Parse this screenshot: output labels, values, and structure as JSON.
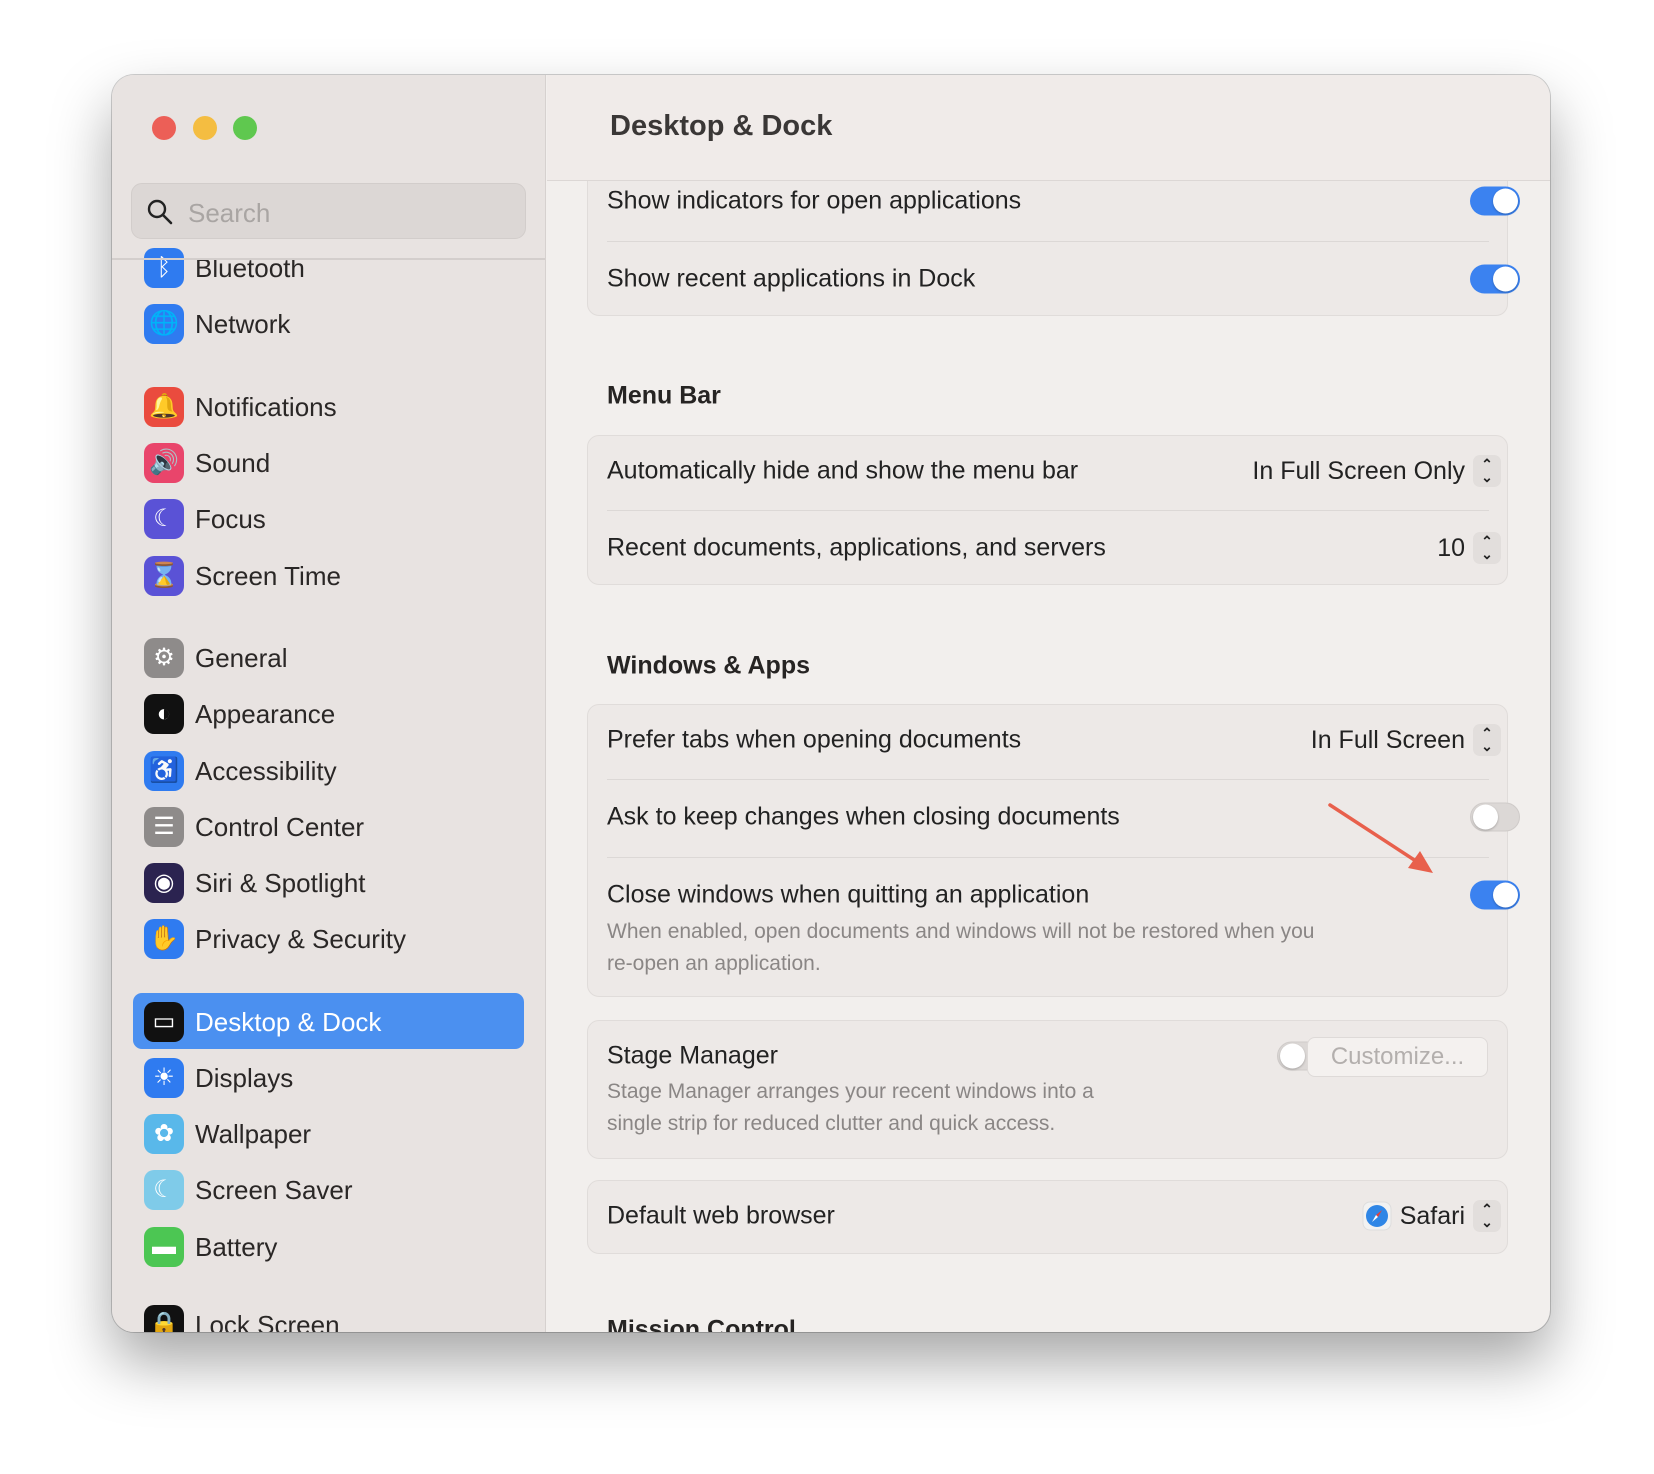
{
  "window": {
    "title": "Desktop & Dock"
  },
  "search": {
    "placeholder": "Search"
  },
  "sidebar": {
    "items": [
      {
        "label": "Bluetooth",
        "icon": "bluetooth-icon",
        "color": "#2f7bf0",
        "glyph": "ᛒ"
      },
      {
        "label": "Network",
        "icon": "globe-icon",
        "color": "#2f7bf0",
        "glyph": "🌐"
      },
      {
        "label": "Notifications",
        "icon": "bell-icon",
        "color": "#ea4b3e",
        "glyph": "🔔"
      },
      {
        "label": "Sound",
        "icon": "speaker-icon",
        "color": "#e9456b",
        "glyph": "🔊"
      },
      {
        "label": "Focus",
        "icon": "moon-icon",
        "color": "#5a52d6",
        "glyph": "☾"
      },
      {
        "label": "Screen Time",
        "icon": "hourglass-icon",
        "color": "#5a52d6",
        "glyph": "⌛"
      },
      {
        "label": "General",
        "icon": "gear-icon",
        "color": "#8e8b8a",
        "glyph": "⚙"
      },
      {
        "label": "Appearance",
        "icon": "appearance-icon",
        "color": "#111111",
        "glyph": "◐"
      },
      {
        "label": "Accessibility",
        "icon": "accessibility-icon",
        "color": "#2f7bf0",
        "glyph": "♿"
      },
      {
        "label": "Control Center",
        "icon": "toggles-icon",
        "color": "#8e8b8a",
        "glyph": "☰"
      },
      {
        "label": "Siri & Spotlight",
        "icon": "siri-icon",
        "color": "#2b2350",
        "glyph": "◉"
      },
      {
        "label": "Privacy & Security",
        "icon": "hand-icon",
        "color": "#2f7bf0",
        "glyph": "✋"
      },
      {
        "label": "Desktop & Dock",
        "icon": "dock-icon",
        "color": "#111111",
        "glyph": "▭",
        "selected": true
      },
      {
        "label": "Displays",
        "icon": "sun-icon",
        "color": "#2f7bf0",
        "glyph": "☀"
      },
      {
        "label": "Wallpaper",
        "icon": "flower-icon",
        "color": "#59b8ea",
        "glyph": "✿"
      },
      {
        "label": "Screen Saver",
        "icon": "screensaver-icon",
        "color": "#7fcbe9",
        "glyph": "☾"
      },
      {
        "label": "Battery",
        "icon": "battery-icon",
        "color": "#4cc653",
        "glyph": "▬"
      },
      {
        "label": "Lock Screen",
        "icon": "lock-icon",
        "color": "#111111",
        "glyph": "🔒"
      }
    ]
  },
  "dock": {
    "show_indicators": {
      "label": "Show indicators for open applications",
      "on": true
    },
    "show_recent": {
      "label": "Show recent applications in Dock",
      "on": true
    }
  },
  "menu_bar": {
    "title": "Menu Bar",
    "auto_hide": {
      "label": "Automatically hide and show the menu bar",
      "value": "In Full Screen Only"
    },
    "recent": {
      "label": "Recent documents, applications, and servers",
      "value": "10"
    }
  },
  "windows_apps": {
    "title": "Windows & Apps",
    "prefer_tabs": {
      "label": "Prefer tabs when opening documents",
      "value": "In Full Screen"
    },
    "ask_keep": {
      "label": "Ask to keep changes when closing documents",
      "on": false
    },
    "close_windows": {
      "label": "Close windows when quitting an application",
      "on": true,
      "desc1": "When enabled, open documents and windows will not be restored when you",
      "desc2": "re-open an application."
    }
  },
  "stage_manager": {
    "label": "Stage Manager",
    "on": false,
    "desc1": "Stage Manager arranges your recent windows into a",
    "desc2": "single strip for reduced clutter and quick access.",
    "customize": "Customize..."
  },
  "browser": {
    "label": "Default web browser",
    "value": "Safari"
  },
  "mission_control": {
    "title": "Mission Control"
  },
  "colors": {
    "accent": "#3b82f0",
    "annotation_arrow": "#e8604c"
  }
}
